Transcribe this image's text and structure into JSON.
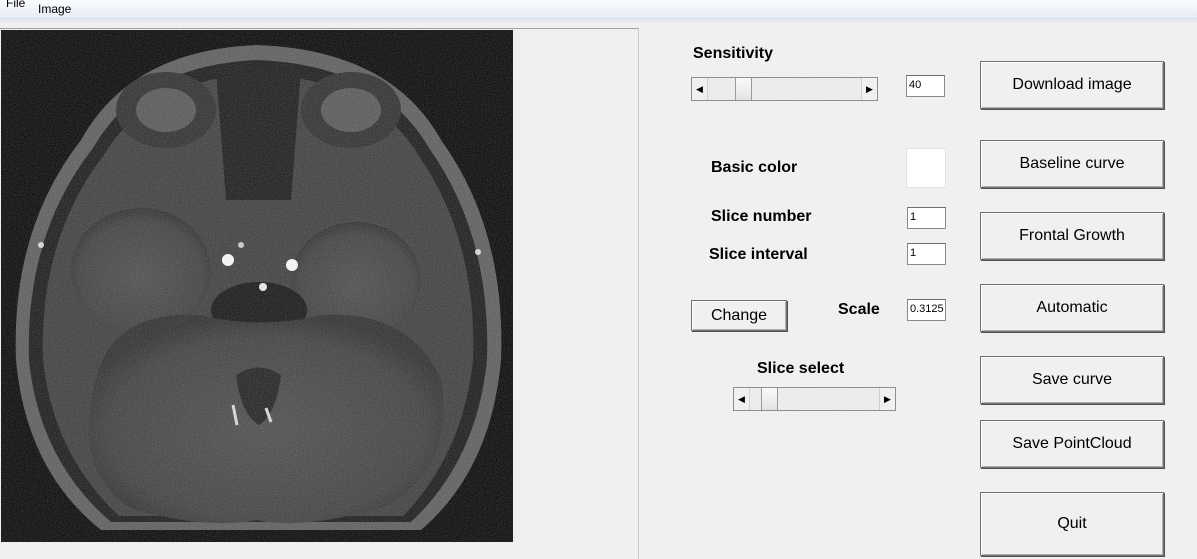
{
  "menu": {
    "file": "File",
    "image": "Image"
  },
  "controls": {
    "sensitivity_label": "Sensitivity",
    "sensitivity_value": "40",
    "sensitivity_fraction": 0.2,
    "basic_color_label": "Basic color",
    "basic_color": "#ffffff",
    "slice_number_label": "Slice number",
    "slice_number_value": "1",
    "slice_interval_label": "Slice interval",
    "slice_interval_value": "1",
    "change_button": "Change",
    "scale_label": "Scale",
    "scale_value": "0.3125",
    "slice_select_label": "Slice select",
    "slice_select_fraction": 0.1
  },
  "actions": {
    "download": "Download image",
    "baseline": "Baseline curve",
    "frontal": "Frontal Growth",
    "automatic": "Automatic",
    "save_curve": "Save curve",
    "save_pointcloud": "Save PointCloud",
    "quit": "Quit"
  }
}
